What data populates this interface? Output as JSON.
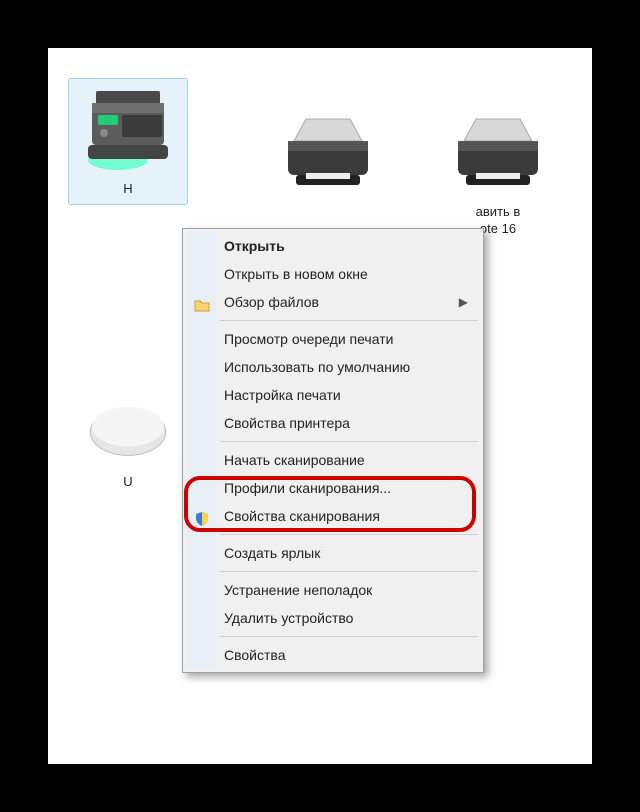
{
  "devices": {
    "selected_mfp_label": "H",
    "printer2_label": "",
    "printer3_label_line1": "авить в",
    "printer3_label_line2": "ote 16",
    "device4_label": "U"
  },
  "menu": {
    "open": "Открыть",
    "open_new_window": "Открыть в новом окне",
    "browse_files": "Обзор файлов",
    "view_queue": "Просмотр очереди печати",
    "set_default": "Использовать по умолчанию",
    "print_settings": "Настройка печати",
    "printer_props": "Свойства принтера",
    "start_scan": "Начать сканирование",
    "scan_profiles": "Профили сканирования...",
    "scan_props": "Свойства сканирования",
    "create_shortcut": "Создать ярлык",
    "troubleshoot": "Устранение неполадок",
    "remove": "Удалить устройство",
    "properties": "Свойства"
  }
}
